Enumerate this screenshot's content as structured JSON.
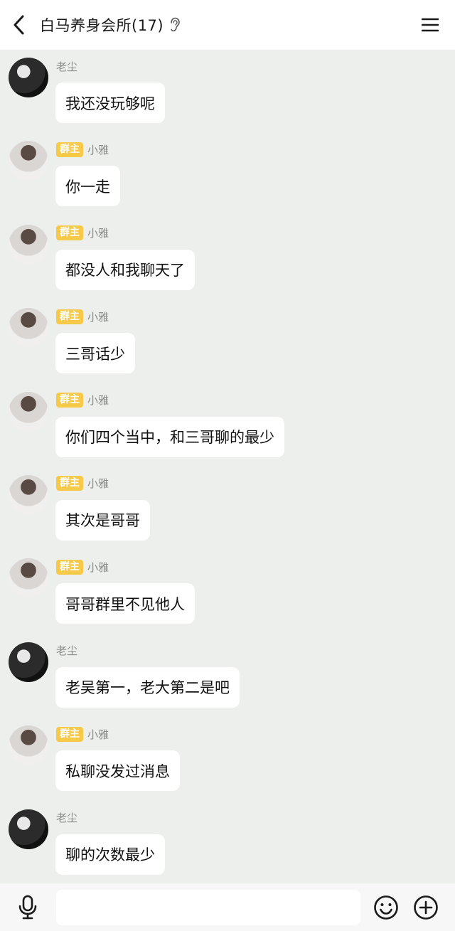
{
  "header": {
    "title": "白马养身会所(17)"
  },
  "labels": {
    "owner_badge": "群主"
  },
  "messages": [
    {
      "sender": "老尘",
      "text": "我还没玩够呢",
      "owner": false,
      "avatar": "dark"
    },
    {
      "sender": "小雅",
      "text": "你一走",
      "owner": true,
      "avatar": "light"
    },
    {
      "sender": "小雅",
      "text": "都没人和我聊天了",
      "owner": true,
      "avatar": "light"
    },
    {
      "sender": "小雅",
      "text": "三哥话少",
      "owner": true,
      "avatar": "light"
    },
    {
      "sender": "小雅",
      "text": "你们四个当中，和三哥聊的最少",
      "owner": true,
      "avatar": "light"
    },
    {
      "sender": "小雅",
      "text": "其次是哥哥",
      "owner": true,
      "avatar": "light"
    },
    {
      "sender": "小雅",
      "text": "哥哥群里不见他人",
      "owner": true,
      "avatar": "light"
    },
    {
      "sender": "老尘",
      "text": "老吴第一，老大第二是吧",
      "owner": false,
      "avatar": "dark"
    },
    {
      "sender": "小雅",
      "text": "私聊没发过消息",
      "owner": true,
      "avatar": "light"
    },
    {
      "sender": "老尘",
      "text": "聊的次数最少",
      "owner": false,
      "avatar": "dark"
    }
  ],
  "input": {
    "value": "",
    "placeholder": ""
  },
  "icons": {
    "back": "back-icon",
    "ear": "ear-icon",
    "menu": "menu-icon",
    "mic": "microphone-icon",
    "emoji": "emoji-icon",
    "plus": "plus-icon"
  }
}
